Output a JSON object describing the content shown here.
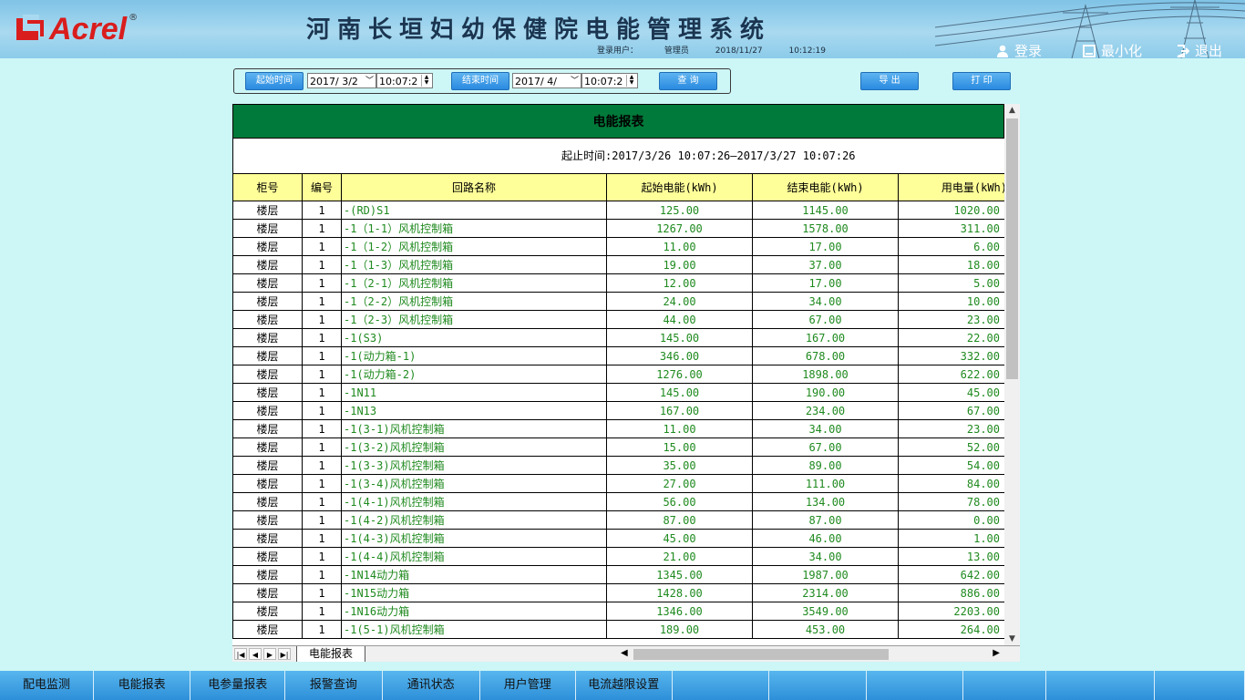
{
  "header": {
    "brand": "Acrel",
    "title": "河南长垣妇幼保健院电能管理系统",
    "login_user_label": "登录用户：",
    "login_user": "管理员",
    "date": "2018/11/27",
    "time": "10:12:19",
    "login_button": "登录",
    "minimize_button": "最小化",
    "logout_button": "退出"
  },
  "toolbar": {
    "start_label": "起始时间",
    "start_date": "2017/ 3/2",
    "start_time": "10:07:2",
    "end_label": "结束时间",
    "end_date": "2017/ 4/",
    "end_time": "10:07:2",
    "query_button": "查 询",
    "export_button": "导 出",
    "print_button": "打 印"
  },
  "report": {
    "title": "电能报表",
    "time_range": "起止时间:2017/3/26 10:07:26—2017/3/27 10:07:26",
    "columns": [
      "柜号",
      "编号",
      "回路名称",
      "起始电能(kWh)",
      "结束电能(kWh)",
      "用电量(kWh)"
    ],
    "rows": [
      [
        "楼层",
        "1",
        "-(RD)S1",
        "125.00",
        "1145.00",
        "1020.00"
      ],
      [
        "楼层",
        "1",
        "-1（1-1）风机控制箱",
        "1267.00",
        "1578.00",
        "311.00"
      ],
      [
        "楼层",
        "1",
        "-1（1-2）风机控制箱",
        "11.00",
        "17.00",
        "6.00"
      ],
      [
        "楼层",
        "1",
        "-1（1-3）风机控制箱",
        "19.00",
        "37.00",
        "18.00"
      ],
      [
        "楼层",
        "1",
        "-1（2-1）风机控制箱",
        "12.00",
        "17.00",
        "5.00"
      ],
      [
        "楼层",
        "1",
        "-1（2-2）风机控制箱",
        "24.00",
        "34.00",
        "10.00"
      ],
      [
        "楼层",
        "1",
        "-1（2-3）风机控制箱",
        "44.00",
        "67.00",
        "23.00"
      ],
      [
        "楼层",
        "1",
        "-1(S3)",
        "145.00",
        "167.00",
        "22.00"
      ],
      [
        "楼层",
        "1",
        "-1(动力箱-1)",
        "346.00",
        "678.00",
        "332.00"
      ],
      [
        "楼层",
        "1",
        "-1(动力箱-2)",
        "1276.00",
        "1898.00",
        "622.00"
      ],
      [
        "楼层",
        "1",
        "-1N11",
        "145.00",
        "190.00",
        "45.00"
      ],
      [
        "楼层",
        "1",
        "-1N13",
        "167.00",
        "234.00",
        "67.00"
      ],
      [
        "楼层",
        "1",
        "-1(3-1)风机控制箱",
        "11.00",
        "34.00",
        "23.00"
      ],
      [
        "楼层",
        "1",
        "-1(3-2)风机控制箱",
        "15.00",
        "67.00",
        "52.00"
      ],
      [
        "楼层",
        "1",
        "-1(3-3)风机控制箱",
        "35.00",
        "89.00",
        "54.00"
      ],
      [
        "楼层",
        "1",
        "-1(3-4)风机控制箱",
        "27.00",
        "111.00",
        "84.00"
      ],
      [
        "楼层",
        "1",
        "-1(4-1)风机控制箱",
        "56.00",
        "134.00",
        "78.00"
      ],
      [
        "楼层",
        "1",
        "-1(4-2)风机控制箱",
        "87.00",
        "87.00",
        "0.00"
      ],
      [
        "楼层",
        "1",
        "-1(4-3)风机控制箱",
        "45.00",
        "46.00",
        "1.00"
      ],
      [
        "楼层",
        "1",
        "-1(4-4)风机控制箱",
        "21.00",
        "34.00",
        "13.00"
      ],
      [
        "楼层",
        "1",
        "-1N14动力箱",
        "1345.00",
        "1987.00",
        "642.00"
      ],
      [
        "楼层",
        "1",
        "-1N15动力箱",
        "1428.00",
        "2314.00",
        "886.00"
      ],
      [
        "楼层",
        "1",
        "-1N16动力箱",
        "1346.00",
        "3549.00",
        "2203.00"
      ],
      [
        "楼层",
        "1",
        "-1(5-1)风机控制箱",
        "189.00",
        "453.00",
        "264.00"
      ]
    ],
    "sheet_tab": "电能报表"
  },
  "bottom_nav": [
    "配电监测",
    "电能报表",
    "电参量报表",
    "报警查询",
    "通讯状态",
    "用户管理",
    "电流越限设置",
    "",
    "",
    "",
    "",
    "",
    ""
  ],
  "colors": {
    "report_title_bg": "#007a3a",
    "header_row_bg": "#ffff99",
    "value_text": "#1f8a1f",
    "logo_red": "#d91d1d",
    "nav_blue": "#2d8fd8"
  }
}
